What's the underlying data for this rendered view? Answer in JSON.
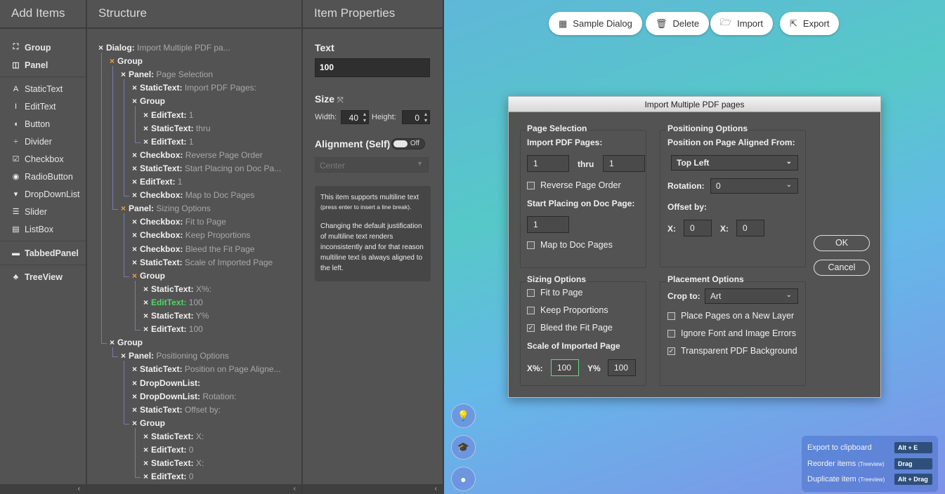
{
  "add_items": {
    "title": "Add Items",
    "groups": [
      [
        {
          "label": "Group",
          "icon": "group-icon",
          "glyph": "⛶",
          "bold": true
        },
        {
          "label": "Panel",
          "icon": "panel-icon",
          "glyph": "◫",
          "bold": true
        }
      ],
      [
        {
          "label": "StaticText",
          "icon": "text-icon",
          "glyph": "A"
        },
        {
          "label": "EditText",
          "icon": "text-cursor-icon",
          "glyph": "I"
        },
        {
          "label": "Button",
          "icon": "toggle-icon",
          "glyph": "◖"
        },
        {
          "label": "Divider",
          "icon": "divider-icon",
          "glyph": "÷"
        },
        {
          "label": "Checkbox",
          "icon": "checkbox-icon",
          "glyph": "☑"
        },
        {
          "label": "RadioButton",
          "icon": "radio-icon",
          "glyph": "◉"
        },
        {
          "label": "DropDownList",
          "icon": "dropdown-icon",
          "glyph": "▾"
        },
        {
          "label": "Slider",
          "icon": "slider-icon",
          "glyph": "☰"
        },
        {
          "label": "ListBox",
          "icon": "listbox-icon",
          "glyph": "▤"
        }
      ],
      [
        {
          "label": "TabbedPanel",
          "icon": "folder-icon",
          "glyph": "▬",
          "bold": true
        }
      ],
      [
        {
          "label": "TreeView",
          "icon": "tree-icon",
          "glyph": "♣",
          "bold": true
        }
      ]
    ]
  },
  "structure": {
    "title": "Structure",
    "nodes": [
      {
        "k": "Dialog:",
        "v": " Import Multiple PDF pa..."
      },
      {
        "k": "Group",
        "v": "",
        "o": true
      },
      {
        "k": "Panel:",
        "v": " Page Selection"
      },
      {
        "k": "StaticText:",
        "v": " Import PDF Pages:"
      },
      {
        "k": "Group",
        "v": ""
      },
      {
        "k": "EditText:",
        "v": " 1"
      },
      {
        "k": "StaticText:",
        "v": " thru"
      },
      {
        "k": "EditText:",
        "v": " 1"
      },
      {
        "k": "Checkbox:",
        "v": " Reverse Page Order"
      },
      {
        "k": "StaticText:",
        "v": " Start Placing on Doc Pa..."
      },
      {
        "k": "EditText:",
        "v": " 1"
      },
      {
        "k": "Checkbox:",
        "v": " Map to Doc Pages"
      },
      {
        "k": "Panel:",
        "v": " Sizing Options",
        "o": true
      },
      {
        "k": "Checkbox:",
        "v": " Fit to Page"
      },
      {
        "k": "Checkbox:",
        "v": " Keep Proportions"
      },
      {
        "k": "Checkbox:",
        "v": " Bleed the Fit Page"
      },
      {
        "k": "StaticText:",
        "v": " Scale of Imported Page"
      },
      {
        "k": "Group",
        "v": "",
        "o": true
      },
      {
        "k": "StaticText:",
        "v": " X%:"
      },
      {
        "k": "EditText:",
        "v": " 100",
        "sel": true
      },
      {
        "k": "StaticText:",
        "v": " Y%"
      },
      {
        "k": "EditText:",
        "v": " 100"
      },
      {
        "k": "Group",
        "v": ""
      },
      {
        "k": "Panel:",
        "v": " Positioning Options"
      },
      {
        "k": "StaticText:",
        "v": " Position on Page Aligne..."
      },
      {
        "k": "DropDownList:",
        "v": ""
      },
      {
        "k": "DropDownList:",
        "v": " Rotation:"
      },
      {
        "k": "StaticText:",
        "v": " Offset by:"
      },
      {
        "k": "Group",
        "v": ""
      },
      {
        "k": "StaticText:",
        "v": " X:"
      },
      {
        "k": "EditText:",
        "v": " 0"
      },
      {
        "k": "StaticText:",
        "v": " X:"
      },
      {
        "k": "EditText:",
        "v": " 0"
      }
    ]
  },
  "props": {
    "title": "Item Properties",
    "text_label": "Text",
    "text_value": "100",
    "size_label": "Size",
    "width_label": "Width:",
    "width_value": "40",
    "height_label": "Height:",
    "height_value": "0",
    "alignment_label": "Alignment (Self)",
    "toggle_text": "Off",
    "align_value": "Center",
    "info1": "This item supports multiline text",
    "info1_small": "(press enter to insert a line break).",
    "info2": "Changing the default justification of multiline text renders inconsistently and for that reason multiline text is always aligned to the left."
  },
  "toolbar": {
    "sample": "Sample Dialog",
    "delete": "Delete",
    "import": "Import",
    "export": "Export"
  },
  "dialog": {
    "title": "Import Multiple PDF pages",
    "page_selection": "Page Selection",
    "import_pages": "Import PDF Pages:",
    "from": "1",
    "thru": "thru",
    "to": "1",
    "reverse": "Reverse Page Order",
    "start_placing": "Start Placing on Doc Page:",
    "start_value": "1",
    "map_pages": "Map to Doc Pages",
    "sizing": "Sizing Options",
    "fit": "Fit to Page",
    "keep": "Keep Proportions",
    "bleed": "Bleed the Fit Page",
    "scale": "Scale of Imported Page",
    "xpct": "X%:",
    "xval": "100",
    "ypct": "Y%",
    "yval": "100",
    "positioning": "Positioning Options",
    "pos_label": "Position on Page Aligned From:",
    "pos_value": "Top Left",
    "rotation": "Rotation:",
    "rotation_value": "0",
    "offset": "Offset by:",
    "x1": "X:",
    "x1v": "0",
    "x2": "X:",
    "x2v": "0",
    "placement": "Placement Options",
    "crop": "Crop to:",
    "crop_value": "Art",
    "new_layer": "Place Pages on a New Layer",
    "ignore": "Ignore Font and Image Errors",
    "transparent": "Transparent PDF Background",
    "ok": "OK",
    "cancel": "Cancel"
  },
  "shortcuts": [
    {
      "label": "Export to clipboard",
      "sub": "",
      "key": "Alt + E"
    },
    {
      "label": "Reorder items",
      "sub": "(Treeview)",
      "key": "Drag"
    },
    {
      "label": "Duplicate item",
      "sub": "(Treeview)",
      "key": "Alt + Drag"
    }
  ]
}
